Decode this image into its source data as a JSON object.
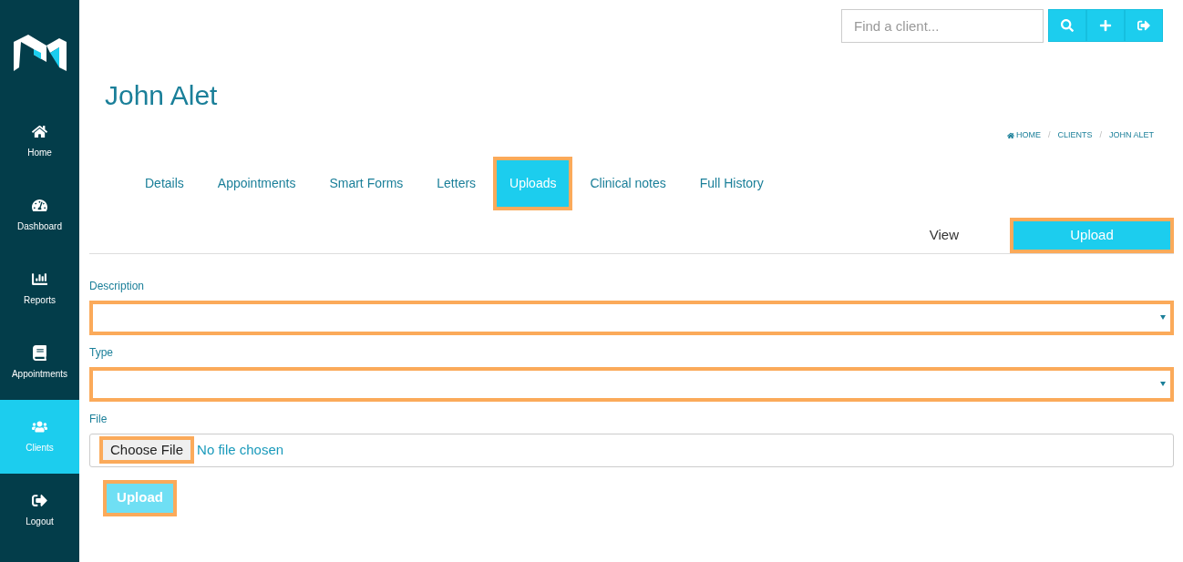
{
  "sidebar": {
    "items": [
      {
        "kind": "home",
        "label": "Home",
        "selected": false
      },
      {
        "kind": "dashboard",
        "label": "Dashboard",
        "selected": false
      },
      {
        "kind": "reports",
        "label": "Reports",
        "selected": false
      },
      {
        "kind": "appointments",
        "label": "Appointments",
        "selected": false
      },
      {
        "kind": "clients",
        "label": "Clients",
        "selected": true
      },
      {
        "kind": "logout",
        "label": "Logout",
        "selected": false
      }
    ]
  },
  "search": {
    "placeholder": "Find a client..."
  },
  "toolbar": [
    {
      "kind": "search"
    },
    {
      "kind": "add"
    },
    {
      "kind": "logout"
    }
  ],
  "title": "John Alet",
  "breadcrumb": [
    {
      "kind": "home",
      "label": "HOME"
    },
    {
      "separator": "/",
      "label": "CLIENTS"
    },
    {
      "separator": "/",
      "label": "JOHN ALET"
    }
  ],
  "tabs": [
    {
      "label": "Details",
      "selected": false,
      "highlighted": false
    },
    {
      "label": "Appointments",
      "selected": false,
      "highlighted": false
    },
    {
      "label": "Smart Forms",
      "selected": false,
      "highlighted": false
    },
    {
      "label": "Letters",
      "selected": false,
      "highlighted": false
    },
    {
      "label": "Uploads",
      "selected": true,
      "highlighted": true
    },
    {
      "label": "Clinical notes",
      "selected": false,
      "highlighted": false
    },
    {
      "label": "Full History",
      "selected": false,
      "highlighted": false
    }
  ],
  "subtabs": [
    {
      "label": "View",
      "selected": false,
      "highlighted": false
    },
    {
      "label": "Upload",
      "selected": true,
      "highlighted": true
    }
  ],
  "form": {
    "fields": [
      {
        "kind": "select",
        "label": "Description",
        "highlighted": true
      },
      {
        "kind": "select",
        "label": "Type",
        "highlighted": true
      },
      {
        "kind": "file",
        "label": "File",
        "button": "Choose File",
        "value": "No file chosen",
        "highlighted": true
      }
    ],
    "submit": {
      "label": "Upload",
      "highlighted": true
    }
  }
}
